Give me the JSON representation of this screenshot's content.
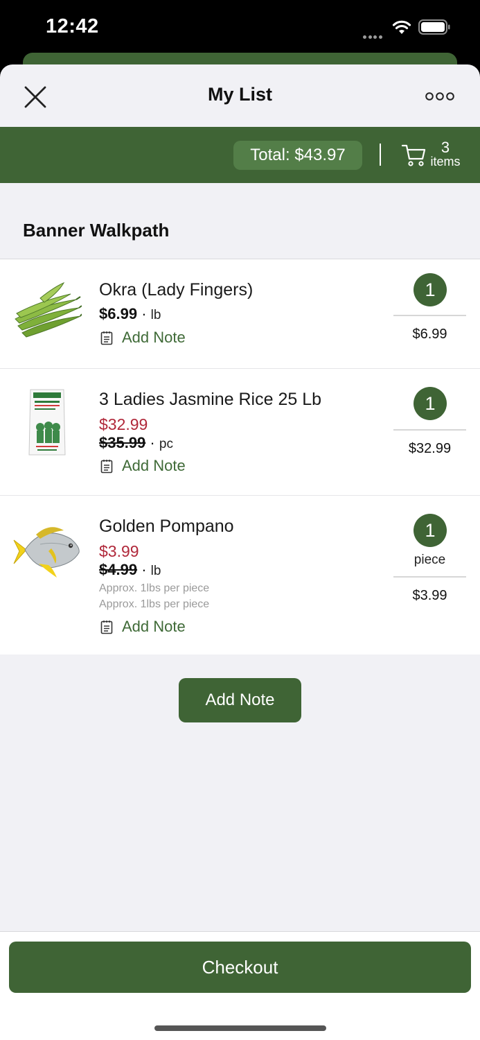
{
  "status_bar": {
    "time": "12:42"
  },
  "nav": {
    "title": "My List"
  },
  "summary": {
    "total": "Total: $43.97",
    "cart_count": "3",
    "cart_items_label": "items"
  },
  "section": {
    "title": "Banner Walkpath"
  },
  "items": [
    {
      "name": "Okra (Lady Fingers)",
      "price": "$6.99",
      "separator": "·",
      "unit": "lb",
      "note_label": "Add Note",
      "quantity": "1",
      "line_total": "$6.99"
    },
    {
      "name": "3 Ladies Jasmine Rice 25 Lb",
      "sale_price": "$32.99",
      "old_price": "$35.99",
      "separator": "·",
      "unit": "pc",
      "note_label": "Add Note",
      "quantity": "1",
      "line_total": "$32.99"
    },
    {
      "name": "Golden Pompano",
      "sale_price": "$3.99",
      "old_price": "$4.99",
      "separator": "·",
      "unit": "lb",
      "approx_1": "Approx. 1lbs per piece",
      "approx_2": "Approx. 1lbs per piece",
      "note_label": "Add Note",
      "quantity": "1",
      "quantity_unit": "piece",
      "line_total": "$3.99"
    }
  ],
  "add_note_button": "Add Note",
  "checkout_button": "Checkout",
  "icons": [
    "wifi-icon",
    "battery-icon",
    "close-icon",
    "more-icon",
    "cart-icon",
    "notepad-icon"
  ],
  "colors": {
    "brand_green": "#3f6435",
    "pill_green": "#537e48",
    "sale_red": "#b0283a",
    "note_green": "#3f6a37",
    "background": "#f1f1f5"
  }
}
